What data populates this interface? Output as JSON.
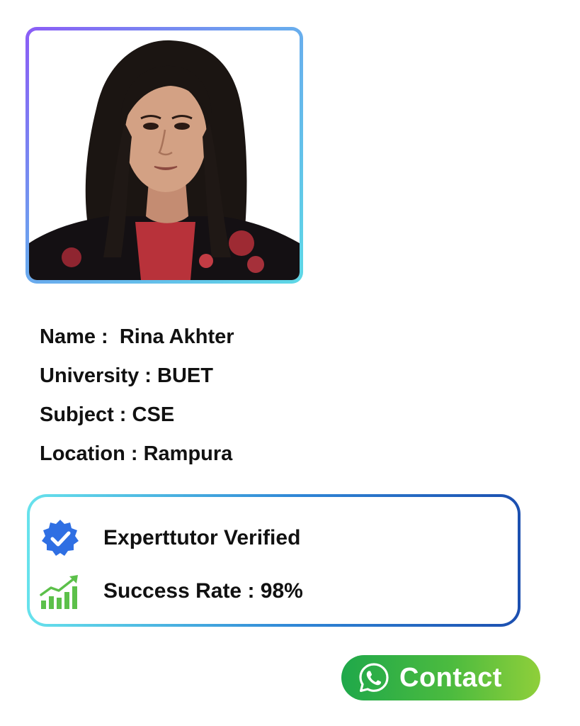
{
  "profile": {
    "photo_alt": "Tutor photo",
    "fields": [
      {
        "label": "Name :",
        "value": "Rina Akhter"
      },
      {
        "label": "University :",
        "value": "BUET"
      },
      {
        "label": "Subject :",
        "value": "CSE"
      },
      {
        "label": "Location :",
        "value": "Rampura"
      }
    ]
  },
  "badges": {
    "verified": {
      "icon": "verified-badge-icon",
      "text": "Experttutor Verified",
      "color": "#2f6fe3"
    },
    "success": {
      "icon": "growth-chart-icon",
      "text": "Success Rate : 98%",
      "color": "#5cc04a"
    }
  },
  "contact": {
    "icon": "whatsapp-icon",
    "label": "Contact"
  },
  "colors": {
    "photo_border_start": "#8b5cf6",
    "photo_border_end": "#5dd8e6",
    "box_border_start": "#67e2ec",
    "box_border_end": "#1c4fb0",
    "button_start": "#1fa84a",
    "button_end": "#8fcf3a"
  }
}
